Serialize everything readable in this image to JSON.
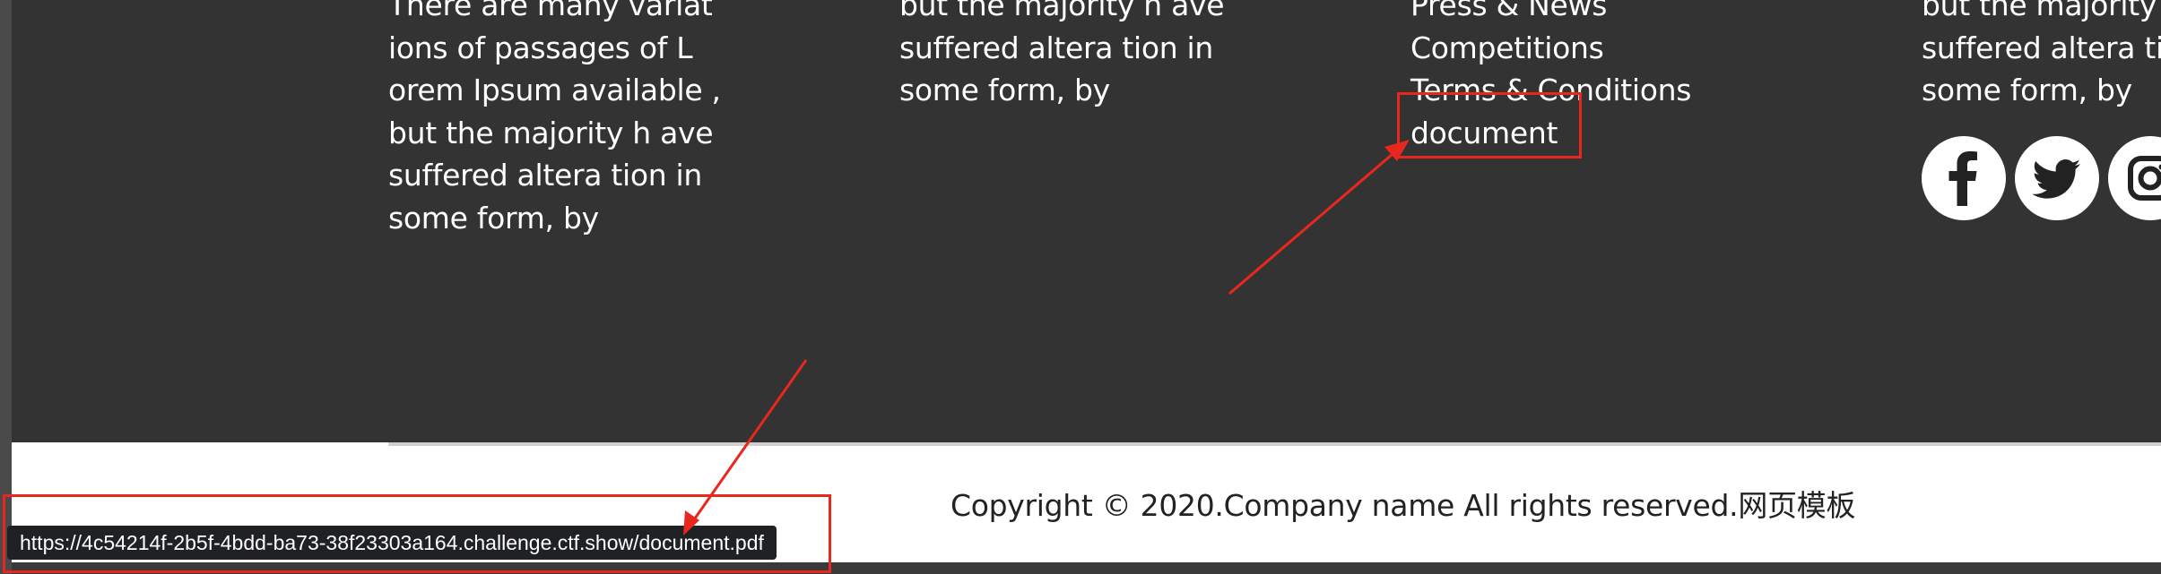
{
  "footer": {
    "col1": {
      "lines": [
        "There are many variat",
        "ions of passages of L",
        "orem Ipsum available ,",
        "but the majority h ave",
        "suffered altera tion in",
        "some form, by"
      ]
    },
    "col2": {
      "lines": [
        "but the majority h ave",
        "suffered altera tion in",
        "some form, by"
      ]
    },
    "col3": {
      "links": [
        "Press & News",
        "Competitions",
        "Terms & Conditions",
        "document"
      ]
    },
    "col4": {
      "lines": [
        "but the majority h ave",
        "suffered altera tion in",
        "some form, by"
      ]
    },
    "social": [
      {
        "icon": "facebook-icon"
      },
      {
        "icon": "twitter-icon"
      },
      {
        "icon": "instagram-icon"
      }
    ]
  },
  "copyright": "Copyright © 2020.Company name All rights reserved.网页模板",
  "status_bar": {
    "url": "https://4c54214f-2b5f-4bdd-ba73-38f23303a164.challenge.ctf.show/document.pdf"
  },
  "colors": {
    "footer_bg": "#333333",
    "annotation": "#e8281e",
    "status_bg": "#202124"
  }
}
